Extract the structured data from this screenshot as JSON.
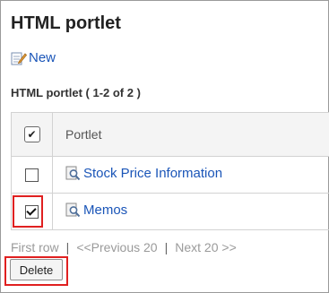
{
  "page": {
    "title": "HTML portlet",
    "new_link": {
      "label": "New",
      "icon": "new-document-icon"
    },
    "list_heading": "HTML portlet ( 1-2 of 2 )"
  },
  "table": {
    "header": {
      "select_all_checked": true,
      "select_all_glyph": "✔",
      "column_label": "Portlet"
    },
    "rows": [
      {
        "name": "Stock Price Information",
        "icon": "portlet-view-icon",
        "checked": false
      },
      {
        "name": "Memos",
        "icon": "portlet-view-icon",
        "checked": true
      }
    ]
  },
  "pager": {
    "first": "First row",
    "separator": "|",
    "previous": "<<Previous 20",
    "next": "Next 20 >>"
  },
  "actions": {
    "delete_label": "Delete"
  },
  "colors": {
    "link": "#1a55b8",
    "highlight": "#e02020",
    "muted": "#9a9a9a"
  }
}
